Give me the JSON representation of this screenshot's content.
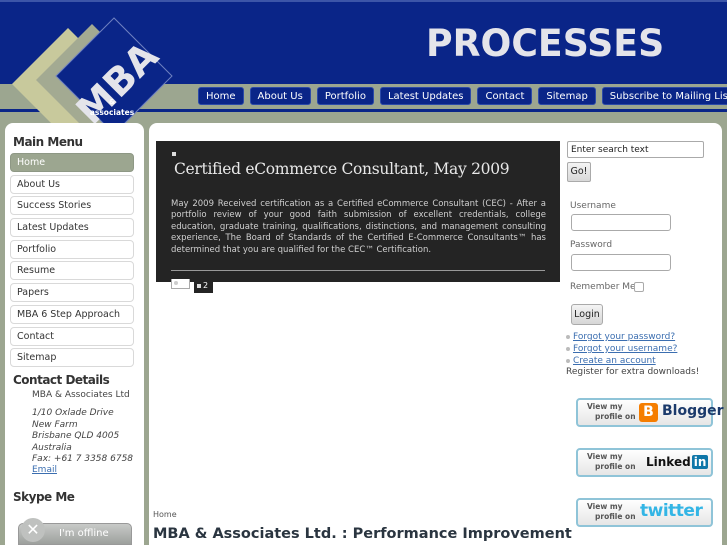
{
  "header": {
    "title": "PROCESSES",
    "logo_text": "MBA",
    "logo_sub": "& associates"
  },
  "nav": [
    {
      "label": "Home"
    },
    {
      "label": "About Us"
    },
    {
      "label": "Portfolio"
    },
    {
      "label": "Latest Updates"
    },
    {
      "label": "Contact"
    },
    {
      "label": "Sitemap"
    },
    {
      "label": "Subscribe to Mailing List"
    }
  ],
  "sidebar": {
    "menu_title": "Main Menu",
    "items": [
      {
        "label": "Home",
        "active": true
      },
      {
        "label": "About Us"
      },
      {
        "label": "Success Stories"
      },
      {
        "label": "Latest Updates"
      },
      {
        "label": "Portfolio"
      },
      {
        "label": "Resume"
      },
      {
        "label": "Papers"
      },
      {
        "label": "MBA 6 Step Approach"
      },
      {
        "label": "Contact"
      },
      {
        "label": "Sitemap"
      }
    ],
    "contact": {
      "title": "Contact Details",
      "name": "MBA & Associates Ltd",
      "address_lines": [
        "1/10 Oxlade Drive",
        "New Farm",
        "Brisbane QLD 4005",
        "Australia",
        "Fax: +61 7 3358 6758"
      ],
      "email_label": "Email"
    },
    "skype": {
      "title": "Skype Me",
      "status": "I'm offline"
    }
  },
  "slideshow": {
    "title": "Certified eCommerce Consultant, May 2009",
    "text": "May 2009 Received certification as a Certified eCommerce Consultant (CEC) - After a portfolio review of your good faith submission of excellent credentials, college education, graduate training, qualifications, distinctions, and management consulting experience, The Board of Standards of the Certified E-Commerce Consultants™ has determined that you are qualified for the CEC™ Certification.",
    "pages": [
      "1",
      "2"
    ],
    "current_page": "2"
  },
  "main": {
    "breadcrumb": "Home",
    "heading": "MBA & Associates Ltd. : Performance Improvement"
  },
  "search": {
    "value": "Enter search text",
    "button": "Go!"
  },
  "login": {
    "username_label": "Username",
    "password_label": "Password",
    "remember_label": "Remember Me",
    "button": "Login",
    "links": [
      "Forgot your password?",
      "Forgot your username?",
      "Create an account"
    ],
    "register_text": "Register for extra downloads!"
  },
  "social": {
    "prefix_line1": "View my",
    "prefix_line2": "profile on",
    "blogger": "Blogger",
    "linkedin": "Linked",
    "linkedin_in": "in",
    "twitter": "twitter"
  },
  "colors": {
    "brand_blue": "#0a2588",
    "sage": "#9ca690",
    "link": "#3b6eb0"
  }
}
